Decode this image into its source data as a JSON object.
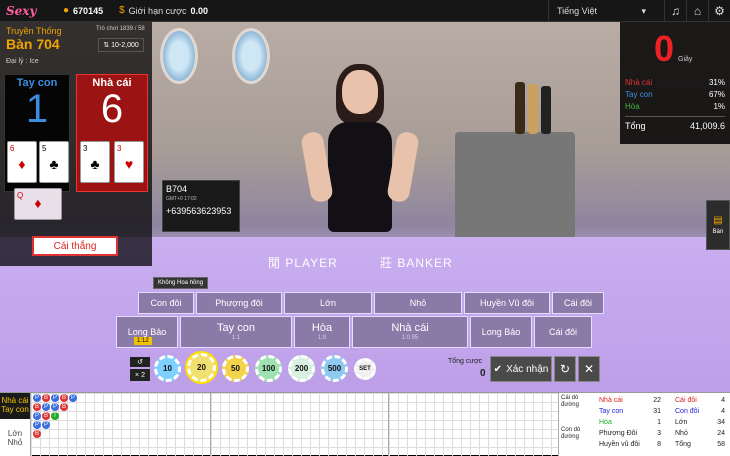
{
  "topbar": {
    "logo": "Sexy",
    "balance": "670145",
    "limit_label": "Giới hạn cược",
    "limit_value": "0.00",
    "language": "Tiếng Việt"
  },
  "table_info": {
    "game_name": "Truyền Thống",
    "table_name": "Bàn 704",
    "round_label": "Trò chơi 1839 / 58",
    "bet_limit": "10-2,000",
    "dealer": "Đại lý : Ice"
  },
  "player": {
    "label": "Tay con",
    "score": "1"
  },
  "banker": {
    "label": "Nhà cái",
    "score": "6"
  },
  "result_button": "Cái thắng",
  "info_card": {
    "table": "B704",
    "time": "GMT+0 17:02",
    "phone": "+639563623953"
  },
  "stats": {
    "countdown": "0",
    "unit": "Giây",
    "rows": [
      {
        "label": "Nhà cái",
        "value": "31%",
        "color": "#e33333"
      },
      {
        "label": "Tay con",
        "value": "67%",
        "color": "#3b8de0"
      },
      {
        "label": "Hòa",
        "value": "1%",
        "color": "#3cb33c"
      }
    ],
    "total_label": "Tổng",
    "total_value": "41,009.6"
  },
  "side_tab": "Bàn",
  "no_commission": "Không Hoa hồng",
  "table_print": {
    "player": "PLAYER",
    "player_cn": "閒",
    "banker": "BANKER",
    "banker_cn": "莊"
  },
  "bets_row1": [
    {
      "name": "Con đôi",
      "sub": "",
      "odds": ""
    },
    {
      "name": "Phượng đôi",
      "sub": "",
      "odds": ""
    },
    {
      "name": "Lớn",
      "sub": "",
      "odds": ""
    },
    {
      "name": "Nhỏ",
      "sub": "",
      "odds": ""
    },
    {
      "name": "Huyền Vũ đôi",
      "sub": "",
      "odds": ""
    },
    {
      "name": "Cái đôi",
      "sub": "",
      "odds": ""
    }
  ],
  "bets_row2": [
    {
      "name": "Long Bảo",
      "odds": ""
    },
    {
      "name": "Tay con",
      "odds": "1:1"
    },
    {
      "name": "Hòa",
      "odds": "1:8"
    },
    {
      "name": "Nhà cái",
      "odds": "1:0.95"
    },
    {
      "name": "Long Bảo",
      "odds": ""
    },
    {
      "name": "Cái đôi",
      "odds": ""
    }
  ],
  "ratio_tag": "1:12",
  "chips": [
    {
      "value": "10",
      "color": "#7fd0ff"
    },
    {
      "value": "20",
      "color": "#f0e070"
    },
    {
      "value": "50",
      "color": "#f3d34a"
    },
    {
      "value": "100",
      "color": "#9ee0b0"
    },
    {
      "value": "200",
      "color": "#d7f0e0"
    },
    {
      "value": "500",
      "color": "#8fc8f0"
    },
    {
      "value": "SET",
      "color": "#f0f0f0"
    }
  ],
  "chip_multiplier": "× 2",
  "total_bet": {
    "label": "Tổng cược",
    "value": "0"
  },
  "confirm_label": "Xác nhận",
  "roadmap": {
    "tags": [
      "Nhà cái",
      "Tay con",
      "Lớn",
      "Nhỏ"
    ],
    "predict": [
      "Cái dò đường",
      "Con dò đường"
    ],
    "summary": [
      {
        "label": "Nhà cái",
        "value": "22",
        "color": "#d22"
      },
      {
        "label": "Tay con",
        "value": "31",
        "color": "#22d"
      },
      {
        "label": "Hòa",
        "value": "1",
        "color": "#2a2"
      },
      {
        "label": "Phượng Đôi",
        "value": "3",
        "color": "#444"
      },
      {
        "label": "Huyền vũ đôi",
        "value": "8",
        "color": "#444"
      }
    ],
    "summary2": [
      {
        "label": "Cái đôi",
        "value": "4",
        "color": "#d22"
      },
      {
        "label": "Con đôi",
        "value": "4",
        "color": "#22d"
      },
      {
        "label": "Lớn",
        "value": "34",
        "color": "#444"
      },
      {
        "label": "Nhỏ",
        "value": "24",
        "color": "#444"
      },
      {
        "label": "Tổng",
        "value": "58",
        "color": "#444"
      }
    ]
  }
}
